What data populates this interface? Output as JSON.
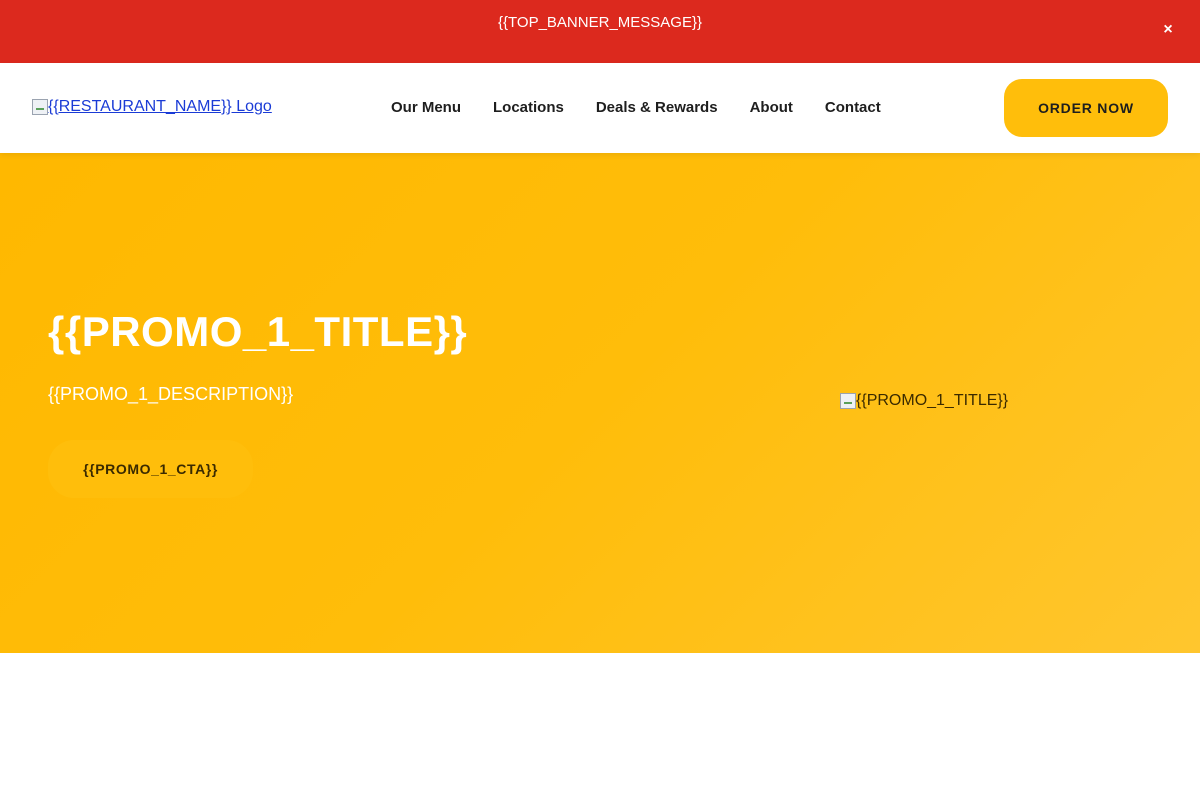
{
  "top_banner": {
    "message": "{{TOP_BANNER_MESSAGE}}",
    "close_label": "×",
    "background": "#dc291e"
  },
  "header": {
    "logo_alt": "{{RESTAURANT_NAME}} Logo",
    "nav": [
      {
        "label": "Our Menu"
      },
      {
        "label": "Locations"
      },
      {
        "label": "Deals & Rewards"
      },
      {
        "label": "About"
      },
      {
        "label": "Contact"
      }
    ],
    "order_button": "ORDER NOW",
    "accent_color": "#ffbe0b"
  },
  "hero": {
    "title": "{{PROMO_1_TITLE}}",
    "description": "{{PROMO_1_DESCRIPTION}}",
    "cta": "{{PROMO_1_CTA}}",
    "image_alt": "{{PROMO_1_TITLE}}",
    "background": "#ffbd0a"
  }
}
